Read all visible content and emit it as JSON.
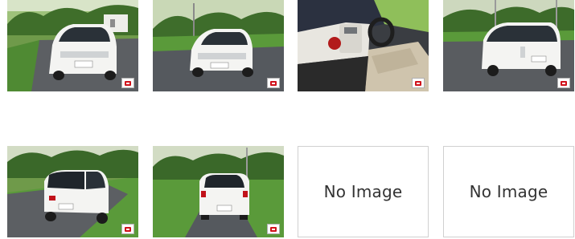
{
  "gallery": {
    "thumbnails": [
      {
        "kind": "photo",
        "view": "front-right exterior",
        "badge_icon": "gallery-badge-icon"
      },
      {
        "kind": "photo",
        "view": "front-left exterior",
        "badge_icon": "gallery-badge-icon"
      },
      {
        "kind": "photo",
        "view": "interior dashboard",
        "badge_icon": "gallery-badge-icon"
      },
      {
        "kind": "photo",
        "view": "rear-left exterior",
        "badge_icon": "gallery-badge-icon"
      },
      {
        "kind": "photo",
        "view": "rear-right exterior",
        "badge_icon": "gallery-badge-icon"
      },
      {
        "kind": "photo",
        "view": "rear exterior",
        "badge_icon": "gallery-badge-icon"
      },
      {
        "kind": "placeholder",
        "label": "No Image"
      },
      {
        "kind": "placeholder",
        "label": "No Image"
      }
    ]
  },
  "colors": {
    "car_body": "#f4f4f2",
    "grass": "#4f8a33",
    "asphalt": "#5c5f63",
    "badge_accent": "#d0121b",
    "placeholder_border": "#d0d0d0"
  }
}
